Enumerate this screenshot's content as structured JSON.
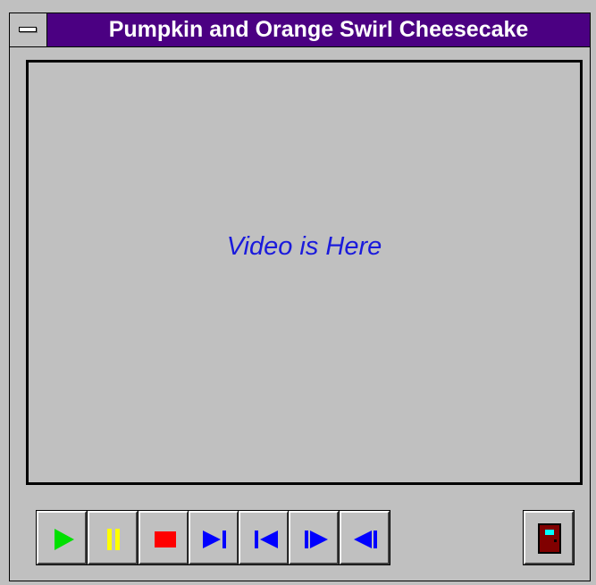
{
  "window": {
    "title": "Pumpkin and Orange Swirl Cheesecake"
  },
  "video": {
    "placeholder_text": "Video is Here"
  },
  "controls": [
    {
      "name": "play-button",
      "icon": "play-icon",
      "color": "#00e000"
    },
    {
      "name": "pause-button",
      "icon": "pause-icon",
      "color": "#ffff00"
    },
    {
      "name": "stop-button",
      "icon": "stop-icon",
      "color": "#ff0000"
    },
    {
      "name": "skip-to-end-button",
      "icon": "skip-end-icon",
      "color": "#0000ff"
    },
    {
      "name": "skip-to-start-button",
      "icon": "skip-start-icon",
      "color": "#0000ff"
    },
    {
      "name": "step-forward-button",
      "icon": "step-forward-icon",
      "color": "#0000ff"
    },
    {
      "name": "step-back-button",
      "icon": "step-back-icon",
      "color": "#0000ff"
    }
  ],
  "exit": {
    "name": "exit-button",
    "icon": "door-exit-icon",
    "door_color": "#800000",
    "window_color": "#00ffff"
  }
}
